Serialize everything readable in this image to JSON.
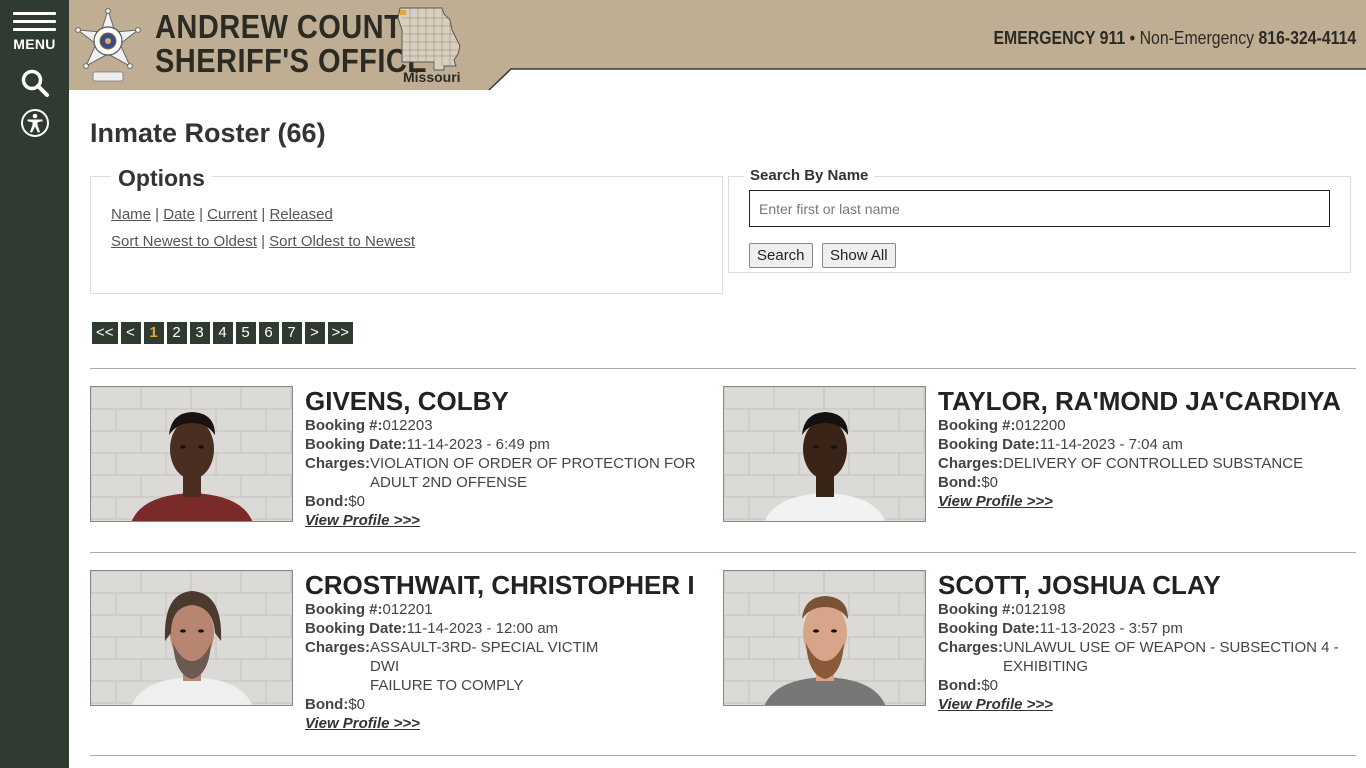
{
  "rail": {
    "menu_label": "MENU",
    "icons": [
      "hamburger-icon",
      "search-icon",
      "accessibility-icon"
    ]
  },
  "header": {
    "title_line1": "ANDREW COUNTY",
    "title_line2": "SHERIFF'S OFFICE",
    "state": "Missouri",
    "emergency_label": "EMERGENCY 911",
    "separator": " • ",
    "nonemergency_label": "Non-Emergency",
    "nonemergency_number": "816-324-4114",
    "colors": {
      "band": "#bfae94",
      "rail": "#2f3a30",
      "accent": "#e0a83a"
    }
  },
  "page": {
    "title": "Inmate Roster (66)"
  },
  "options": {
    "legend": "Options",
    "filters": [
      "Name",
      "Date",
      "Current",
      "Released"
    ],
    "sorts": [
      "Sort Newest to Oldest",
      "Sort Oldest to Newest"
    ]
  },
  "search": {
    "label": "Search By Name",
    "placeholder": "Enter first or last name",
    "search_button": "Search",
    "show_all_button": "Show All"
  },
  "pager": {
    "items": [
      "<<",
      "<",
      "1",
      "2",
      "3",
      "4",
      "5",
      "6",
      "7",
      ">",
      ">>"
    ],
    "active": "1"
  },
  "labels": {
    "booking_no": "Booking #:",
    "booking_date": "Booking Date:",
    "charges": "Charges:",
    "bond": "Bond:",
    "view_profile": "View Profile >>>"
  },
  "inmates": [
    {
      "name": "GIVENS, COLBY",
      "booking_no": "012203",
      "booking_date": "11-14-2023 - 6:49 pm",
      "charges": [
        "VIOLATION OF ORDER OF PROTECTION FOR ADULT 2ND OFFENSE"
      ],
      "bond": "$0"
    },
    {
      "name": "TAYLOR, RA'MOND JA'CARDIYA",
      "booking_no": "012200",
      "booking_date": "11-14-2023 - 7:04 am",
      "charges": [
        "DELIVERY OF CONTROLLED SUBSTANCE"
      ],
      "bond": "$0"
    },
    {
      "name": "CROSTHWAIT, CHRISTOPHER I",
      "booking_no": "012201",
      "booking_date": "11-14-2023 - 12:00 am",
      "charges": [
        "ASSAULT-3RD- SPECIAL VICTIM",
        "DWI",
        "FAILURE TO COMPLY"
      ],
      "bond": "$0"
    },
    {
      "name": "SCOTT, JOSHUA CLAY",
      "booking_no": "012198",
      "booking_date": "11-13-2023 - 3:57 pm",
      "charges": [
        "UNLAWUL USE OF WEAPON - SUBSECTION 4 - EXHIBITING"
      ],
      "bond": "$0"
    }
  ]
}
